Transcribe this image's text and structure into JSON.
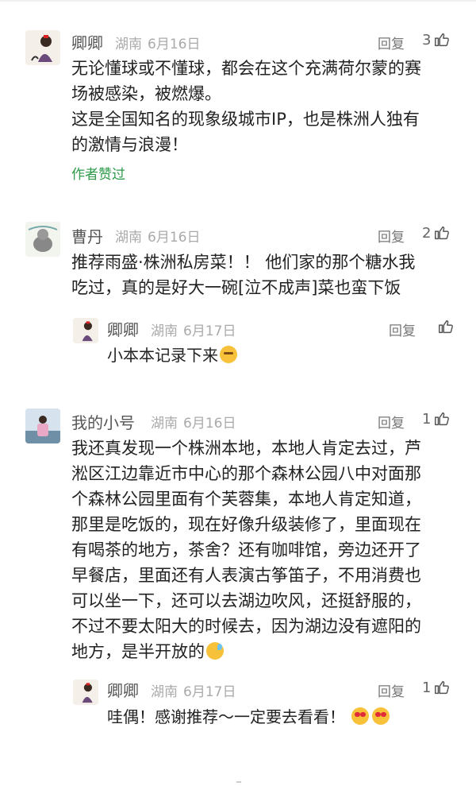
{
  "comments": [
    {
      "user": "卿卿",
      "region": "湖南",
      "date": "6月16日",
      "reply_label": "回复",
      "likes": "3",
      "lines": [
        "无论懂球或不懂球，都会在这个充满荷尔蒙的赛",
        "场被感染，被燃爆。",
        "这是全国知名的现象级城市IP，也是株洲人独有",
        "的激情与浪漫！"
      ],
      "author_liked": "作者赞过"
    },
    {
      "user": "曹丹",
      "region": "湖南",
      "date": "6月16日",
      "reply_label": "回复",
      "likes": "2",
      "lines": [
        "推荐雨盛·株洲私房菜！！ 他们家的那个糖水我",
        "吃过，真的是好大一碗[泣不成声]菜也蛮下饭"
      ],
      "replies": [
        {
          "user": "卿卿",
          "region": "湖南",
          "date": "6月17日",
          "reply_label": "回复",
          "likes": "",
          "text": "小本本记录下来",
          "emoji": "thinking-face"
        }
      ]
    },
    {
      "user": "我的小号",
      "region": "湖南",
      "date": "6月16日",
      "reply_label": "回复",
      "likes": "1",
      "lines": [
        "我还真发现一个株洲本地，本地人肯定去过，芦",
        "淞区江边靠近市中心的那个森林公园八中对面那",
        "个森林公园里面有个芙蓉集，本地人肯定知道，",
        "那里是吃饭的，现在好像升级装修了，里面现在",
        "有喝茶的地方，茶舍？还有咖啡馆，旁边还开了",
        "早餐店，里面还有人表演古筝笛子，不用消费也",
        "可以坐一下，还可以去湖边吹风，还挺舒服的，",
        "不过不要太阳大的时候去，因为湖边没有遮阳的",
        "地方，是半开放的"
      ],
      "last_line_emoji": "sweat-laugh-face",
      "replies": [
        {
          "user": "卿卿",
          "region": "湖南",
          "date": "6月17日",
          "reply_label": "回复",
          "likes": "1",
          "text": "哇偶！感谢推荐～一定要去看看！",
          "emoji": "heart-eyes-face"
        }
      ]
    }
  ],
  "colors": {
    "author_liked": "#2e9a4a",
    "meta": "#aaaaaa",
    "name": "#555555"
  }
}
